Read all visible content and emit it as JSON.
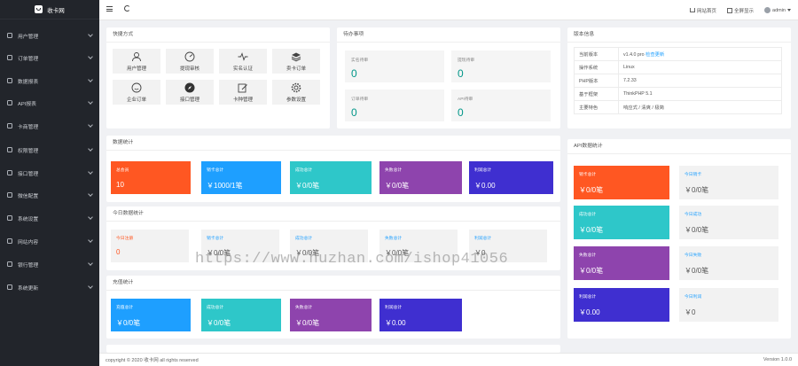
{
  "brand": {
    "name": "收卡网"
  },
  "sidebar": {
    "items": [
      {
        "label": "用户管理",
        "icon": "user-icon"
      },
      {
        "label": "订单管理",
        "icon": "order-icon"
      },
      {
        "label": "数据报表",
        "icon": "report-icon"
      },
      {
        "label": "API报表",
        "icon": "api-report-icon"
      },
      {
        "label": "卡商管理",
        "icon": "card-merchant-icon"
      },
      {
        "label": "权限管理",
        "icon": "permission-icon"
      },
      {
        "label": "接口管理",
        "icon": "interface-icon"
      },
      {
        "label": "微信配置",
        "icon": "wechat-icon"
      },
      {
        "label": "系统设置",
        "icon": "settings-icon"
      },
      {
        "label": "网站内容",
        "icon": "content-icon"
      },
      {
        "label": "银行管理",
        "icon": "bank-icon"
      },
      {
        "label": "系统更新",
        "icon": "update-icon"
      }
    ]
  },
  "topbar": {
    "home_label": "网站首页",
    "fullscreen_label": "全屏显示",
    "user_label": "admin"
  },
  "quick": {
    "title": "快捷方式",
    "items": [
      {
        "label": "用户管理",
        "icon": "user-icon"
      },
      {
        "label": "提现审核",
        "icon": "dashboard-icon"
      },
      {
        "label": "实名认证",
        "icon": "pulse-icon"
      },
      {
        "label": "卖卡订单",
        "icon": "layers-icon"
      },
      {
        "label": "企业订单",
        "icon": "smile-icon"
      },
      {
        "label": "接口管理",
        "icon": "compass-icon"
      },
      {
        "label": "卡种管理",
        "icon": "edit-icon"
      },
      {
        "label": "参数设置",
        "icon": "gear-icon"
      }
    ]
  },
  "pending": {
    "title": "待办事项",
    "items": [
      {
        "label": "实名待审",
        "value": "0"
      },
      {
        "label": "提现待审",
        "value": "0"
      },
      {
        "label": "订单待审",
        "value": "0"
      },
      {
        "label": "API待审",
        "value": "0"
      }
    ]
  },
  "version": {
    "title": "版本信息",
    "rows": [
      {
        "k": "当前版本",
        "v": "v1.4.0 pro",
        "link": "检查更新"
      },
      {
        "k": "操作系统",
        "v": "Linux",
        "link": ""
      },
      {
        "k": "PHP版本",
        "v": "7.2.33",
        "link": ""
      },
      {
        "k": "基于框架",
        "v": "ThinkPHP 5.1",
        "link": ""
      },
      {
        "k": "主要特色",
        "v": "响应式 / 清爽 / 极简",
        "link": ""
      }
    ]
  },
  "stats": {
    "title": "数据统计",
    "cards": [
      {
        "label": "总会员",
        "value": "10",
        "color": "#ff5722"
      },
      {
        "label": "销卡总计",
        "value": "￥1000/1笔",
        "color": "#1e9fff"
      },
      {
        "label": "成功总计",
        "value": "￥0/0笔",
        "color": "#2ec7c9"
      },
      {
        "label": "失败总计",
        "value": "￥0/0笔",
        "color": "#8e44ad"
      },
      {
        "label": "利润总计",
        "value": "￥0.00",
        "color": "#3f2fd0"
      }
    ]
  },
  "today": {
    "title": "今日数据统计",
    "cards": [
      {
        "label": "今日注册",
        "value": "0"
      },
      {
        "label": "销卡总计",
        "value": "￥0/0笔"
      },
      {
        "label": "成功总计",
        "value": "￥0/0笔"
      },
      {
        "label": "失败总计",
        "value": "￥0/0笔"
      },
      {
        "label": "利润总计",
        "value": "￥0"
      }
    ]
  },
  "recharge": {
    "title": "充值统计",
    "cards": [
      {
        "label": "充值总计",
        "value": "￥0/0笔",
        "color": "#1e9fff"
      },
      {
        "label": "成功总计",
        "value": "￥0/0笔",
        "color": "#2ec7c9"
      },
      {
        "label": "失败总计",
        "value": "￥0/0笔",
        "color": "#8e44ad"
      },
      {
        "label": "利润总计",
        "value": "￥0.00",
        "color": "#3f2fd0"
      }
    ]
  },
  "api": {
    "title": "API数据统计",
    "cards": [
      {
        "label": "销卡总计",
        "value": "￥0/0笔",
        "color": "#ff5722"
      },
      {
        "label": "成功总计",
        "value": "￥0/0笔",
        "color": "#2ec7c9"
      },
      {
        "label": "失败总计",
        "value": "￥0/0笔",
        "color": "#8e44ad"
      },
      {
        "label": "利润总计",
        "value": "￥0.00",
        "color": "#3f2fd0"
      }
    ],
    "today": [
      {
        "label": "今日销卡",
        "value": "￥0/0笔"
      },
      {
        "label": "今日成功",
        "value": "￥0/0笔"
      },
      {
        "label": "今日失败",
        "value": "￥0/0笔"
      },
      {
        "label": "今日利润",
        "value": "￥0"
      }
    ]
  },
  "footer": {
    "copyright": "copyright © 2020 收卡网 all rights reserved",
    "version": "Version 1.0.0"
  },
  "watermark": "https://www.huzhan.com/ishop41056"
}
